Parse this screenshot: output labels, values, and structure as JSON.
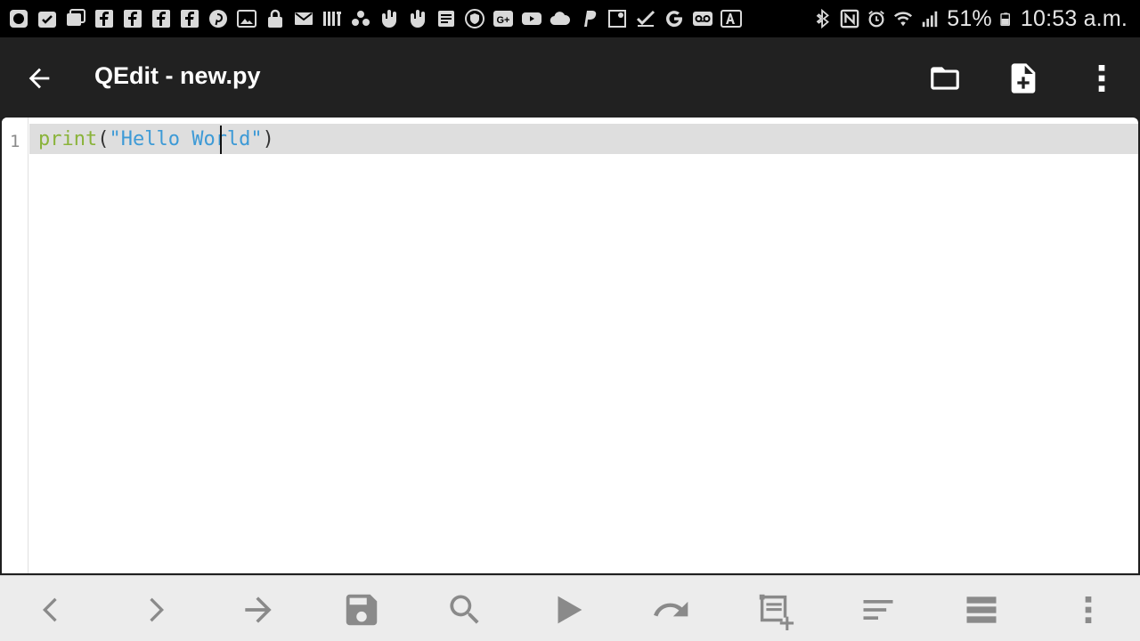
{
  "status_bar": {
    "notification_icons": [
      "s-icon",
      "calendar-check-icon",
      "slides-icon",
      "facebook-icon",
      "facebook-icon",
      "facebook-icon",
      "facebook-icon",
      "pinterest-icon",
      "image-icon",
      "lock-icon",
      "mail-icon",
      "ifttt-icon",
      "dots-icon",
      "hand-icon",
      "hand-icon",
      "document-icon",
      "shield-icon",
      "gplus-icon",
      "youtube-icon",
      "cloud-icon",
      "paypal-icon",
      "map-icon",
      "check-icon",
      "google-icon",
      "voicemail-icon",
      "translate-icon"
    ],
    "battery": "51%",
    "time": "10:53 a.m."
  },
  "app_bar": {
    "title": "QEdit - new.py",
    "actions": [
      "folder-open-icon",
      "new-file-icon",
      "more-vert-icon"
    ]
  },
  "editor": {
    "line_numbers": [
      "1"
    ],
    "code": {
      "fn": "print",
      "open": "(",
      "string": "\"Hello World\"",
      "close": ")"
    }
  },
  "toolbar": {
    "buttons": [
      "prev-icon",
      "next-icon",
      "goto-icon",
      "save-icon",
      "search-icon",
      "run-icon",
      "undo-icon",
      "select-add-icon",
      "format-icon",
      "list-icon",
      "more-vert-icon"
    ]
  },
  "colors": {
    "app_bar": "#212121",
    "keyword": "#8ab33a",
    "string": "#3d9ad6",
    "current_line": "#dedede",
    "toolbar": "#ececec"
  }
}
